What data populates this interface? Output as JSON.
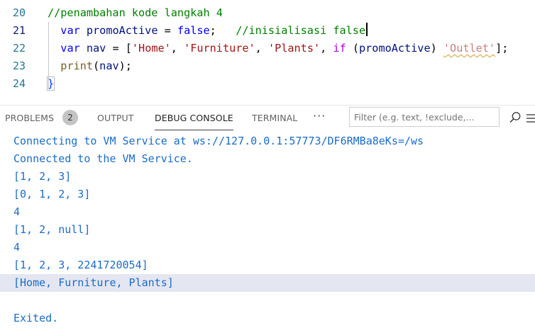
{
  "editor": {
    "lines": [
      {
        "number": "20",
        "tokens": [
          {
            "t": "//penambahan kode langkah 4",
            "c": "tk-cmt"
          }
        ]
      },
      {
        "number": "21",
        "tokens": [
          {
            "t": "  ",
            "c": "tk-punc"
          },
          {
            "t": "var",
            "c": "tk-kw"
          },
          {
            "t": " ",
            "c": "tk-punc"
          },
          {
            "t": "promoActive",
            "c": "tk-id"
          },
          {
            "t": " = ",
            "c": "tk-punc"
          },
          {
            "t": "false",
            "c": "tk-kw"
          },
          {
            "t": ";   ",
            "c": "tk-punc"
          },
          {
            "t": "//inisialisasi false",
            "c": "tk-cmt"
          }
        ]
      },
      {
        "number": "22",
        "tokens": [
          {
            "t": "  ",
            "c": "tk-punc"
          },
          {
            "t": "var",
            "c": "tk-kw"
          },
          {
            "t": " ",
            "c": "tk-punc"
          },
          {
            "t": "nav",
            "c": "tk-id"
          },
          {
            "t": " = [",
            "c": "tk-punc"
          },
          {
            "t": "'Home'",
            "c": "tk-str"
          },
          {
            "t": ", ",
            "c": "tk-punc"
          },
          {
            "t": "'Furniture'",
            "c": "tk-str"
          },
          {
            "t": ", ",
            "c": "tk-punc"
          },
          {
            "t": "'Plants'",
            "c": "tk-str"
          },
          {
            "t": ", ",
            "c": "tk-punc"
          },
          {
            "t": "if",
            "c": "tk-ctl"
          },
          {
            "t": " (",
            "c": "tk-punc"
          },
          {
            "t": "promoActive",
            "c": "tk-id"
          },
          {
            "t": ") ",
            "c": "tk-punc"
          },
          {
            "t": "'Outlet'",
            "c": "tk-str-warn"
          },
          {
            "t": "];",
            "c": "tk-punc"
          }
        ]
      },
      {
        "number": "23",
        "tokens": [
          {
            "t": "  ",
            "c": "tk-punc"
          },
          {
            "t": "print",
            "c": "tk-fn"
          },
          {
            "t": "(",
            "c": "tk-punc"
          },
          {
            "t": "nav",
            "c": "tk-id"
          },
          {
            "t": ");",
            "c": "tk-punc"
          }
        ]
      },
      {
        "number": "24",
        "tokens": [
          {
            "t": "}",
            "c": "tk-brace"
          }
        ]
      }
    ]
  },
  "panel": {
    "tabs": {
      "problems": "PROBLEMS",
      "problems_count": "2",
      "output": "OUTPUT",
      "debug_console": "DEBUG CONSOLE",
      "terminal": "TERMINAL",
      "more": "···"
    },
    "filter": {
      "placeholder": "Filter (e.g. text, !exclude,...",
      "value": ""
    },
    "icons": {
      "filter_search": "search-icon",
      "view_as_tree": "list-icon"
    }
  },
  "console": {
    "lines": [
      "Connecting to VM Service at ws://127.0.0.1:57773/DF6RMBa8eKs=/ws",
      "Connected to the VM Service.",
      "[1, 2, 3]",
      "[0, 1, 2, 3]",
      "4",
      "[1, 2, null]",
      "4",
      "[1, 2, 3, 2241720054]",
      "[Home, Furniture, Plants]",
      "",
      "Exited."
    ],
    "highlighted_line": 8
  },
  "colors": {
    "console_text": "#1a6cc9",
    "line_highlight": "#e4e6f1",
    "comment": "#008000",
    "keyword": "#0000ff"
  }
}
